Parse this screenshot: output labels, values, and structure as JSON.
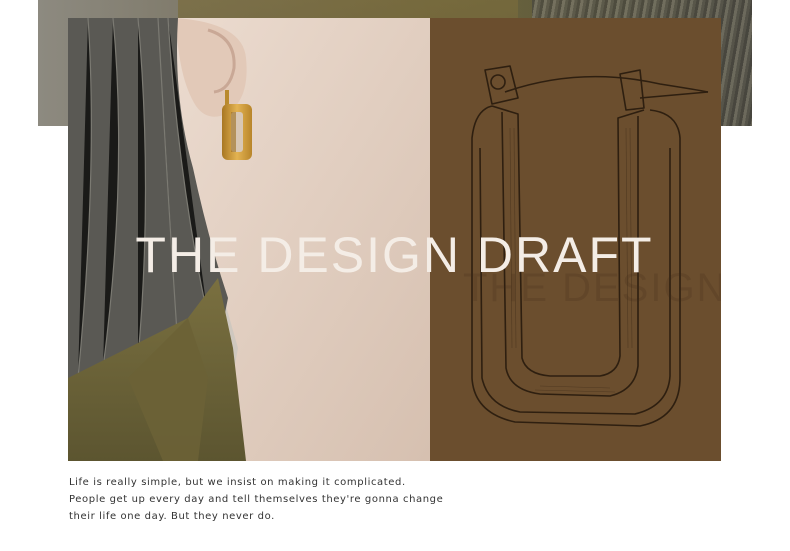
{
  "hero": {
    "title": "THE DESIGN DRAFT"
  },
  "caption": {
    "lines": [
      "Life is really simple, but we insist on making it complicated.",
      "People get up every day and tell themselves they're gonna change",
      "their life one day. But they never do."
    ]
  },
  "colors": {
    "sketch_background": "#6b4e2e",
    "title_text": "#f4ede6",
    "caption_text": "#333333",
    "jacket_olive": "#6b6234",
    "earring_gold": "#c9952e"
  },
  "icons": {
    "earring_photo": "gold-rectangular-hoop-earring-photo",
    "earring_sketch": "hoop-earring-sketch"
  }
}
